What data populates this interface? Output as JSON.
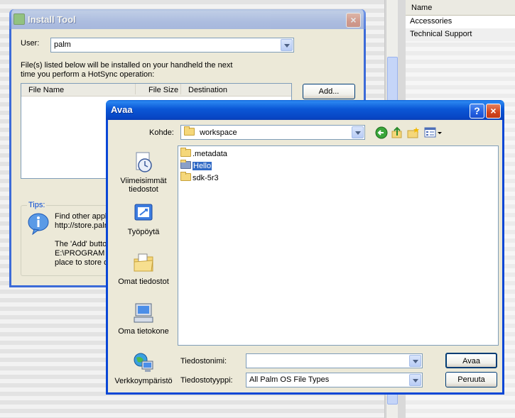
{
  "background": {
    "list_header": "Name",
    "list_items": [
      "Accessories",
      "Technical Support"
    ]
  },
  "install_tool": {
    "title": "Install Tool",
    "user_label": "User:",
    "user_value": "palm",
    "info_text_line1": "File(s) listed below will be installed on your handheld the next",
    "info_text_line2": "time you perform a HotSync operation:",
    "columns": [
      "File Name",
      "File Size",
      "Destination"
    ],
    "add_button": "Add...",
    "tips_label": "Tips:",
    "tips_line1": "Find other appli",
    "tips_line2": "http://store.palm",
    "tips_line3": "The 'Add' button",
    "tips_line4": "E:\\PROGRAM",
    "tips_line5": "place to store d"
  },
  "open_dialog": {
    "title": "Avaa",
    "help_glyph": "?",
    "close_glyph": "×",
    "lookin_label": "Kohde:",
    "lookin_value": "workspace",
    "places": [
      {
        "label_line1": "Viimeisimmät",
        "label_line2": "tiedostot",
        "icon": "recent-documents-icon"
      },
      {
        "label_line1": "Työpöytä",
        "label_line2": "",
        "icon": "desktop-icon"
      },
      {
        "label_line1": "Omat tiedostot",
        "label_line2": "",
        "icon": "my-documents-icon"
      },
      {
        "label_line1": "Oma tietokone",
        "label_line2": "",
        "icon": "my-computer-icon"
      },
      {
        "label_line1": "Verkkoympäristö",
        "label_line2": "",
        "icon": "network-places-icon"
      }
    ],
    "files": [
      {
        "name": ".metadata",
        "selected": false
      },
      {
        "name": "Hello",
        "selected": true
      },
      {
        "name": "sdk-5r3",
        "selected": false
      }
    ],
    "filename_label": "Tiedostonimi:",
    "filename_value": "",
    "filetype_label": "Tiedostotyyppi:",
    "filetype_value": "All Palm OS File Types",
    "open_button": "Avaa",
    "cancel_button": "Peruuta"
  }
}
